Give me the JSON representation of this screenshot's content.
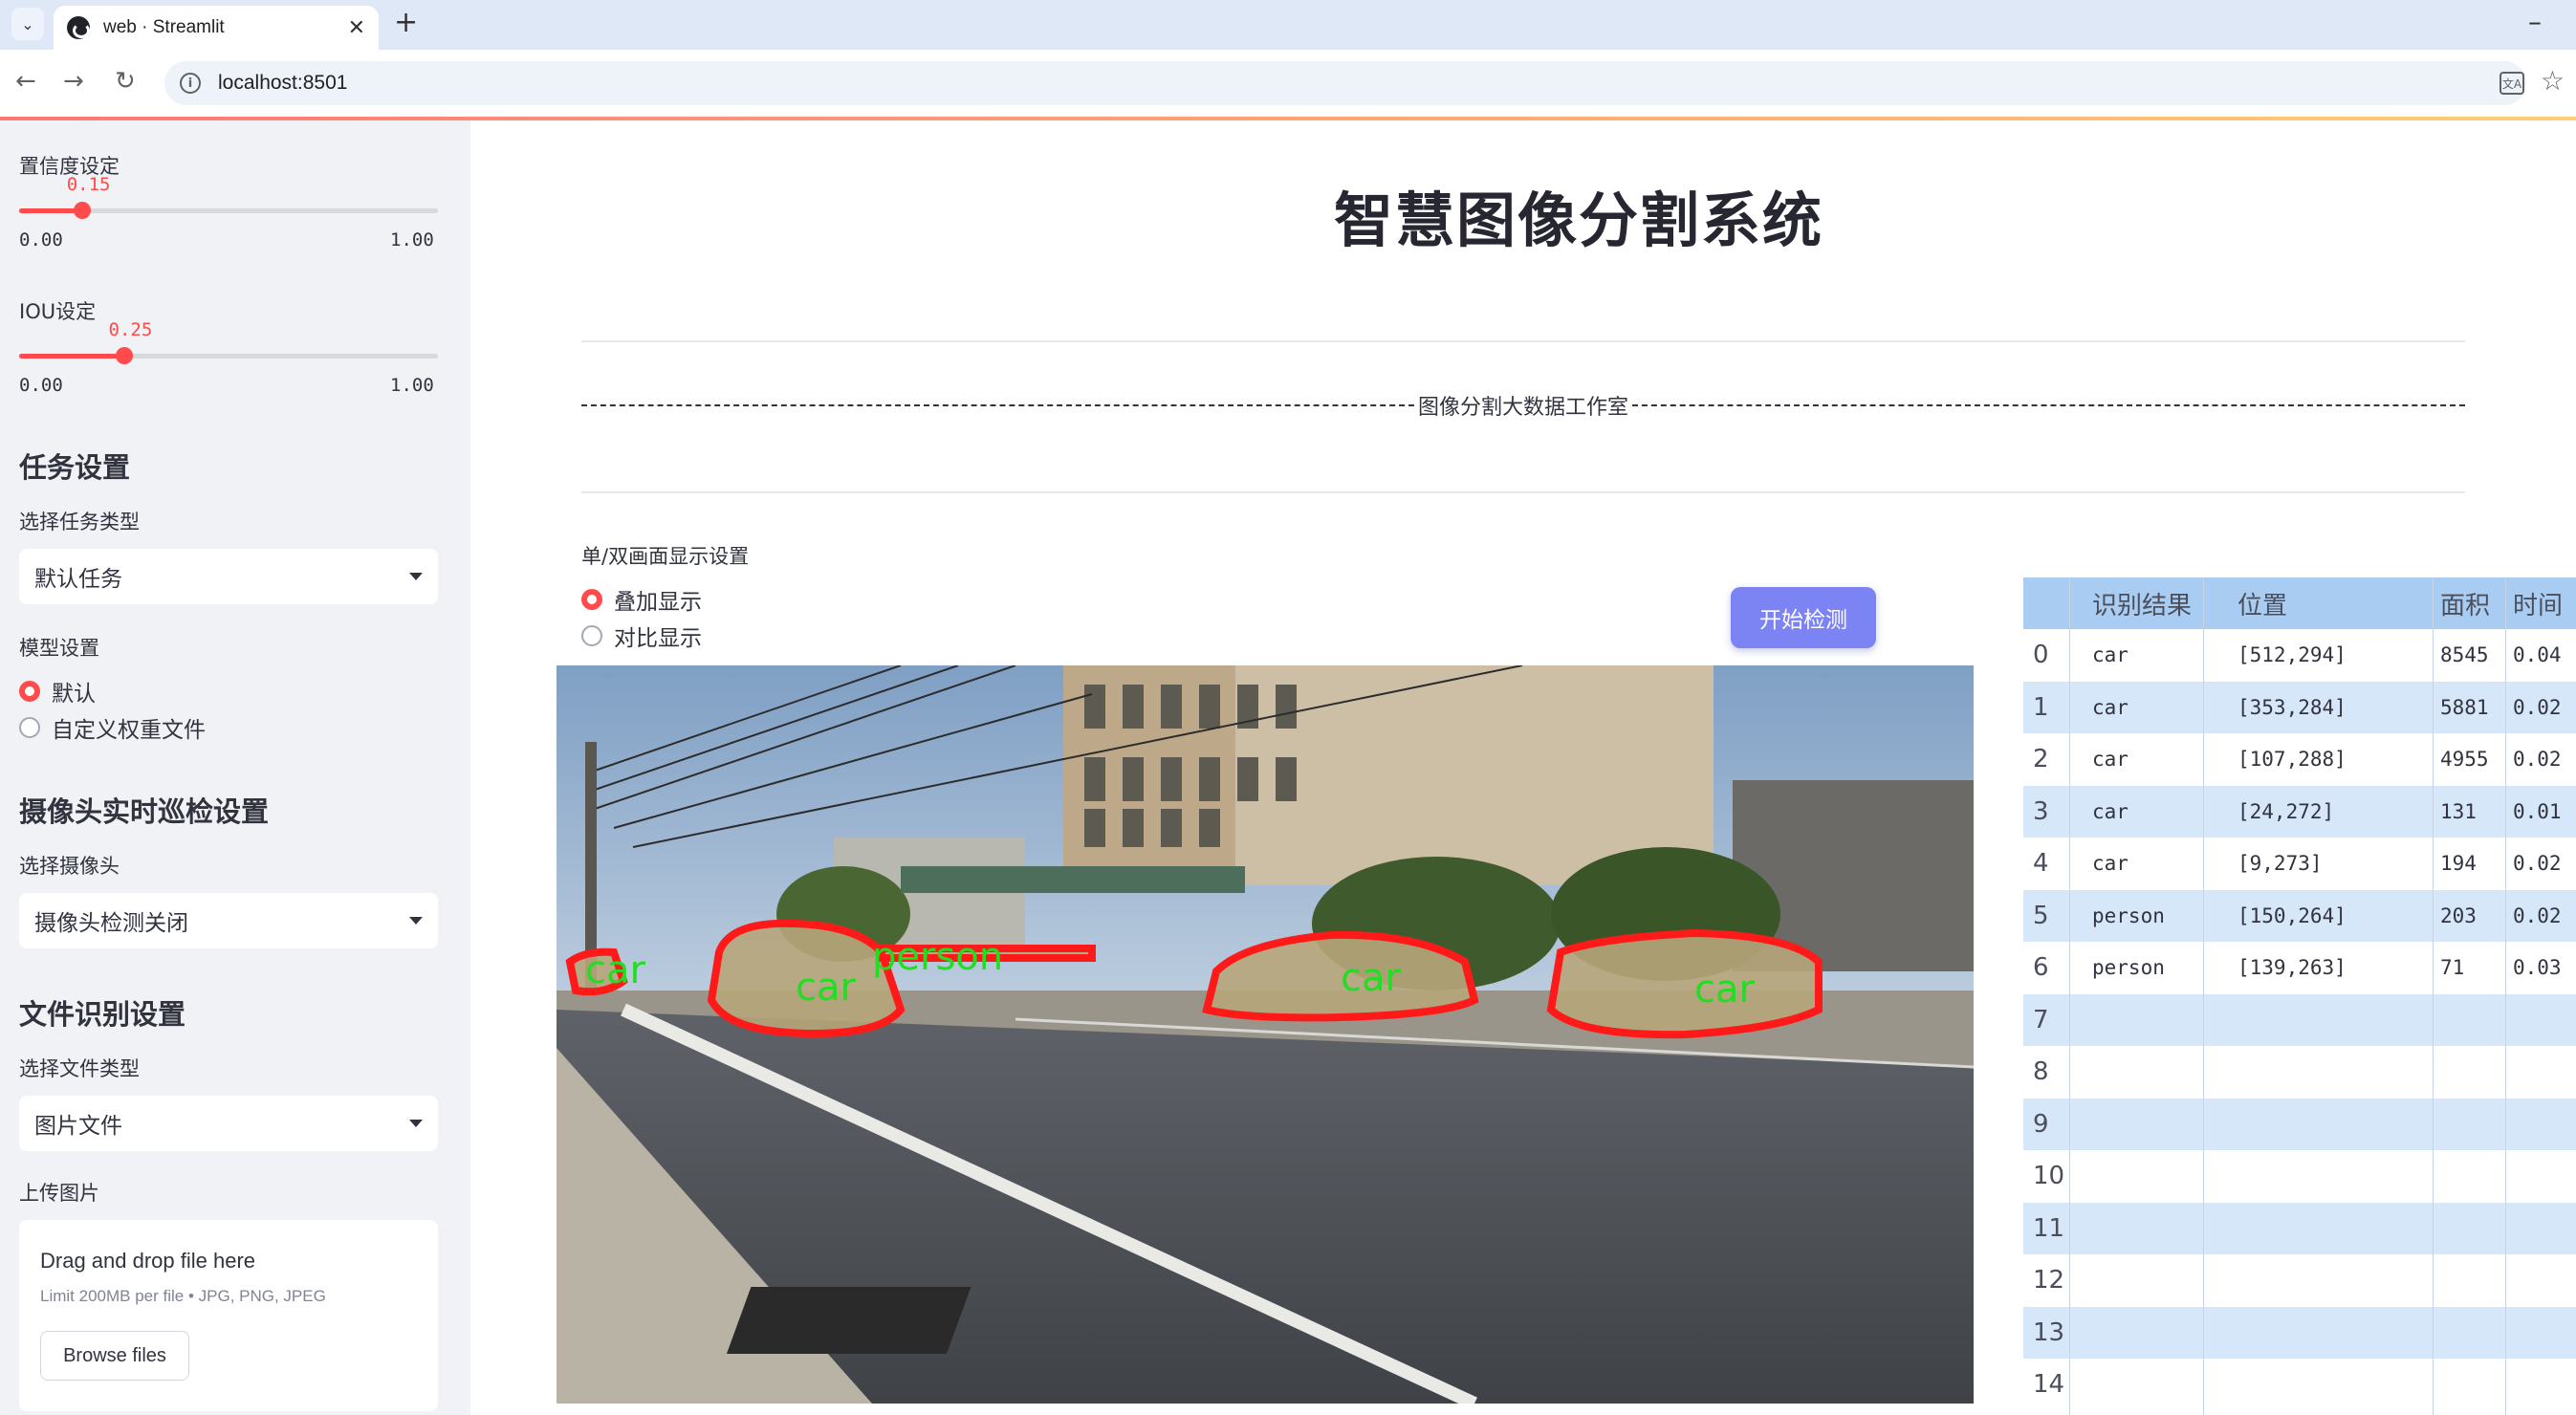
{
  "browser": {
    "tab_title": "web · Streamlit",
    "url": "localhost:8501"
  },
  "sidebar": {
    "confidence": {
      "label": "置信度设定",
      "value": "0.15",
      "fraction": 0.15,
      "min": "0.00",
      "max": "1.00"
    },
    "iou": {
      "label": "IOU设定",
      "value": "0.25",
      "fraction": 0.25,
      "min": "0.00",
      "max": "1.00"
    },
    "task_header": "任务设置",
    "task_type_label": "选择任务类型",
    "task_type_value": "默认任务",
    "model_label": "模型设置",
    "model_options": [
      "默认",
      "自定义权重文件"
    ],
    "model_selected": 0,
    "camera_header": "摄像头实时巡检设置",
    "camera_label": "选择摄像头",
    "camera_value": "摄像头检测关闭",
    "file_header": "文件识别设置",
    "file_type_label": "选择文件类型",
    "file_type_value": "图片文件",
    "upload_label": "上传图片",
    "uploader": {
      "title": "Drag and drop file here",
      "subtitle": "Limit 200MB per file • JPG, PNG, JPEG",
      "button": "Browse files"
    }
  },
  "main": {
    "title": "智慧图像分割系统",
    "subtitle": "图像分割大数据工作室",
    "display_label": "单/双画面显示设置",
    "display_options": [
      "叠加显示",
      "对比显示"
    ],
    "display_selected": 0,
    "start_button": "开始检测",
    "detections_labels": [
      "car",
      "car",
      "car",
      "person"
    ]
  },
  "table": {
    "headers": [
      "",
      "识别结果",
      "位置",
      "面积",
      "时间"
    ],
    "rows": [
      [
        "0",
        "car",
        "[512,294]",
        "8545",
        "0.04"
      ],
      [
        "1",
        "car",
        "[353,284]",
        "5881",
        "0.02"
      ],
      [
        "2",
        "car",
        "[107,288]",
        "4955",
        "0.02"
      ],
      [
        "3",
        "car",
        "[24,272]",
        "131",
        "0.01"
      ],
      [
        "4",
        "car",
        "[9,273]",
        "194",
        "0.02"
      ],
      [
        "5",
        "person",
        "[150,264]",
        "203",
        "0.02"
      ],
      [
        "6",
        "person",
        "[139,263]",
        "71",
        "0.03"
      ],
      [
        "7",
        "",
        "",
        "",
        ""
      ],
      [
        "8",
        "",
        "",
        "",
        ""
      ],
      [
        "9",
        "",
        "",
        "",
        ""
      ],
      [
        "10",
        "",
        "",
        "",
        ""
      ],
      [
        "11",
        "",
        "",
        "",
        ""
      ],
      [
        "12",
        "",
        "",
        "",
        ""
      ],
      [
        "13",
        "",
        "",
        "",
        ""
      ],
      [
        "14",
        "",
        "",
        "",
        ""
      ]
    ]
  },
  "colors": {
    "accent": "#ff4b4b",
    "button": "#7c83f3",
    "table_header": "#a9cdf2",
    "table_stripe": "#d7e7fa",
    "mask_outline": "#ff0000",
    "mask_label": "#22dd22"
  }
}
